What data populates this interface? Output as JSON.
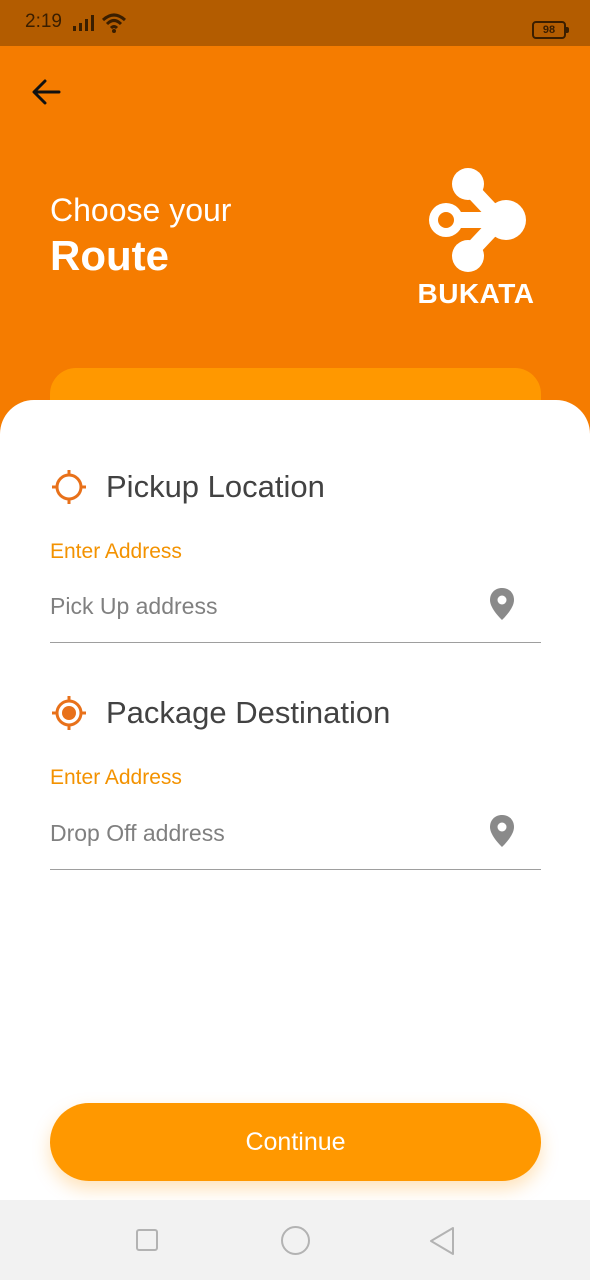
{
  "status_bar": {
    "time": "2:19",
    "battery": "98",
    "icons": [
      "signal-icon",
      "wifi-icon",
      "battery-icon"
    ]
  },
  "header": {
    "back_icon": "arrow-left-icon",
    "title_line1": "Choose your",
    "title_line2": "Route",
    "brand_name": "BUKATA",
    "background_color": "#f57c00"
  },
  "pickup": {
    "icon": "crosshair-icon",
    "title": "Pickup Location",
    "label": "Enter Address",
    "placeholder": "Pick Up address",
    "value": "",
    "trailing_icon": "map-pin-icon"
  },
  "destination": {
    "icon": "target-icon",
    "title": "Package Destination",
    "label": "Enter Address",
    "placeholder": "Drop Off address",
    "value": "",
    "trailing_icon": "map-pin-icon"
  },
  "actions": {
    "continue_label": "Continue"
  },
  "nav_bar": {
    "icons": [
      "recent-apps-icon",
      "home-icon",
      "back-icon"
    ]
  },
  "colors": {
    "accent": "#ff9800",
    "header": "#f57c00",
    "label": "#f39200",
    "icon_orange": "#e8711a"
  }
}
